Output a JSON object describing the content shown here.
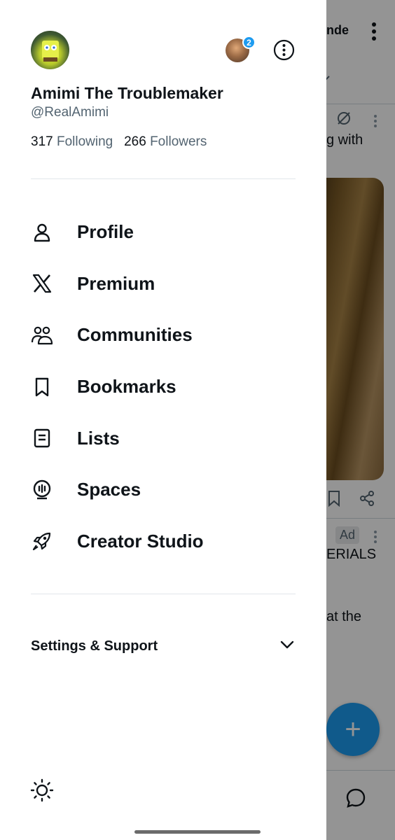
{
  "feed": {
    "header_fragment": "nde",
    "post_fragment": "g with",
    "ad_badge": "Ad",
    "ad_fragment": "ERIALS",
    "ad_fragment2": "at the",
    "fab_icon": "plus-icon"
  },
  "profile": {
    "display_name": "Amimi The Troublemaker",
    "handle": "@RealAmimi",
    "following_count": "317",
    "following_label": "Following",
    "followers_count": "266",
    "followers_label": "Followers",
    "account_badge_count": "2"
  },
  "menu": {
    "items": [
      {
        "label": "Profile",
        "icon": "person-icon"
      },
      {
        "label": "Premium",
        "icon": "x-logo-icon"
      },
      {
        "label": "Communities",
        "icon": "people-icon"
      },
      {
        "label": "Bookmarks",
        "icon": "bookmark-icon"
      },
      {
        "label": "Lists",
        "icon": "list-icon"
      },
      {
        "label": "Spaces",
        "icon": "microphone-icon"
      },
      {
        "label": "Creator Studio",
        "icon": "rocket-icon"
      }
    ]
  },
  "settings": {
    "label": "Settings & Support"
  },
  "colors": {
    "accent": "#1d9bf0",
    "text_primary": "#0f1419",
    "text_secondary": "#536471"
  }
}
